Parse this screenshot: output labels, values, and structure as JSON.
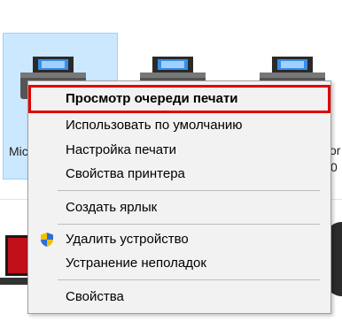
{
  "printers": [
    {
      "label": "Mic"
    },
    {
      "label": ""
    },
    {
      "label": "or"
    }
  ],
  "printer_third_suffix": "0",
  "context_menu": {
    "items": [
      {
        "label": "Просмотр очереди печати"
      },
      {
        "label": "Использовать по умолчанию"
      },
      {
        "label": "Настройка печати"
      },
      {
        "label": "Свойства принтера"
      },
      {
        "label": "Создать ярлык"
      },
      {
        "label": "Удалить устройство"
      },
      {
        "label": "Устранение неполадок"
      },
      {
        "label": "Свойства"
      }
    ]
  },
  "colors": {
    "selection_bg": "#cce8ff",
    "highlight_border": "#e00000",
    "menu_bg": "#f2f2f2"
  }
}
